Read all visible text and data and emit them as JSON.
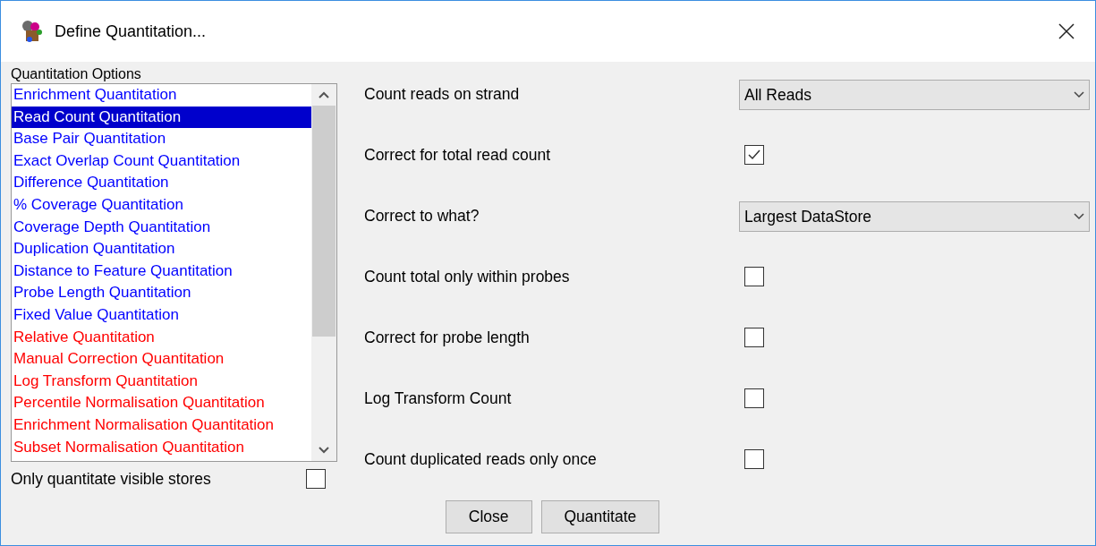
{
  "window": {
    "title": "Define Quantitation..."
  },
  "options": {
    "label": "Quantitation Options",
    "items": [
      {
        "label": "Enrichment Quantitation",
        "color": "#0000ff",
        "selected": false
      },
      {
        "label": "Read Count Quantitation",
        "selected": true
      },
      {
        "label": "Base Pair Quantitation",
        "color": "#0000ff",
        "selected": false
      },
      {
        "label": "Exact Overlap Count Quantitation",
        "color": "#0000ff",
        "selected": false
      },
      {
        "label": "Difference Quantitation",
        "color": "#0000ff",
        "selected": false
      },
      {
        "label": "% Coverage Quantitation",
        "color": "#0000ff",
        "selected": false
      },
      {
        "label": "Coverage Depth Quantitation",
        "color": "#0000ff",
        "selected": false
      },
      {
        "label": "Duplication Quantitation",
        "color": "#0000ff",
        "selected": false
      },
      {
        "label": "Distance to Feature Quantitation",
        "color": "#0000ff",
        "selected": false
      },
      {
        "label": "Probe Length Quantitation",
        "color": "#0000ff",
        "selected": false
      },
      {
        "label": "Fixed Value Quantitation",
        "color": "#0000ff",
        "selected": false
      },
      {
        "label": "Relative Quantitation",
        "color": "#ff0000",
        "selected": false
      },
      {
        "label": "Manual Correction Quantitation",
        "color": "#ff0000",
        "selected": false
      },
      {
        "label": "Log Transform Quantitation",
        "color": "#ff0000",
        "selected": false
      },
      {
        "label": "Percentile Normalisation Quantitation",
        "color": "#ff0000",
        "selected": false
      },
      {
        "label": "Enrichment Normalisation Quantitation",
        "color": "#ff0000",
        "selected": false
      },
      {
        "label": "Subset Normalisation Quantitation",
        "color": "#ff0000",
        "selected": false
      }
    ],
    "visible_only": {
      "label": "Only quantitate visible stores",
      "checked": false
    }
  },
  "settings": [
    {
      "kind": "dropdown",
      "label": "Count reads on strand",
      "value": "All Reads"
    },
    {
      "kind": "checkbox",
      "label": "Correct for total read count",
      "checked": true
    },
    {
      "kind": "dropdown",
      "label": "Correct to what?",
      "value": "Largest DataStore"
    },
    {
      "kind": "checkbox",
      "label": "Count total only within probes",
      "checked": false
    },
    {
      "kind": "checkbox",
      "label": "Correct for probe length",
      "checked": false
    },
    {
      "kind": "checkbox",
      "label": "Log Transform Count",
      "checked": false
    },
    {
      "kind": "checkbox",
      "label": "Count duplicated reads only once",
      "checked": false
    }
  ],
  "buttons": [
    "Close",
    "Quantitate"
  ]
}
